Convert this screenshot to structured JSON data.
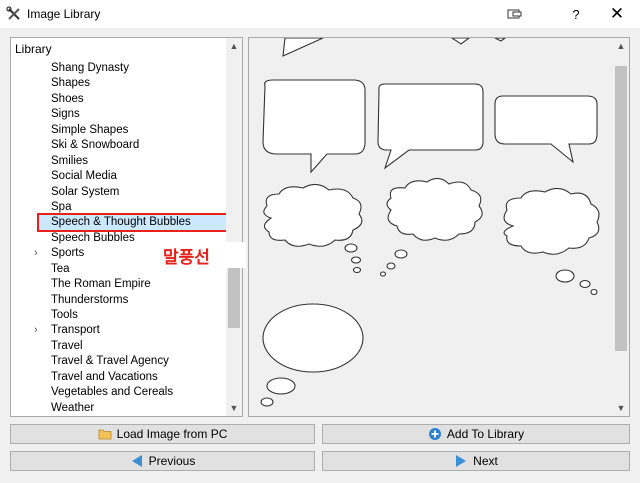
{
  "window": {
    "title": "Image Library",
    "help_glyph": "?",
    "close_glyph": "✕"
  },
  "tree": {
    "root_label": "Library",
    "items": [
      {
        "label": "Shang Dynasty",
        "expandable": false
      },
      {
        "label": "Shapes",
        "expandable": false
      },
      {
        "label": "Shoes",
        "expandable": false
      },
      {
        "label": "Signs",
        "expandable": false
      },
      {
        "label": "Simple Shapes",
        "expandable": false
      },
      {
        "label": "Ski & Snowboard",
        "expandable": false
      },
      {
        "label": "Smilies",
        "expandable": false
      },
      {
        "label": "Social Media",
        "expandable": false
      },
      {
        "label": "Solar System",
        "expandable": false
      },
      {
        "label": "Spa",
        "expandable": false
      },
      {
        "label": "Speech & Thought Bubbles",
        "expandable": false,
        "selected": true
      },
      {
        "label": "Speech Bubbles",
        "expandable": false
      },
      {
        "label": "Sports",
        "expandable": true
      },
      {
        "label": "Tea",
        "expandable": false
      },
      {
        "label": "The Roman Empire",
        "expandable": false
      },
      {
        "label": "Thunderstorms",
        "expandable": false
      },
      {
        "label": "Tools",
        "expandable": false
      },
      {
        "label": "Transport",
        "expandable": true
      },
      {
        "label": "Travel",
        "expandable": false
      },
      {
        "label": "Travel & Travel Agency",
        "expandable": false
      },
      {
        "label": "Travel and Vacations",
        "expandable": false
      },
      {
        "label": "Vegetables and Cereals",
        "expandable": false
      },
      {
        "label": "Weather",
        "expandable": false
      }
    ],
    "expander_glyph": "›",
    "scroll_position": 0.74
  },
  "annotation": {
    "text": "말풍선",
    "color": "#e8211b"
  },
  "preview": {
    "scroll_position": 0.2
  },
  "buttons": {
    "load": "Load Image from PC",
    "add": "Add To Library",
    "previous": "Previous",
    "next": "Next"
  },
  "colors": {
    "selection_bg": "#cce8ff",
    "highlight_border": "#e8211b",
    "arrow_blue": "#3d8fd6"
  }
}
